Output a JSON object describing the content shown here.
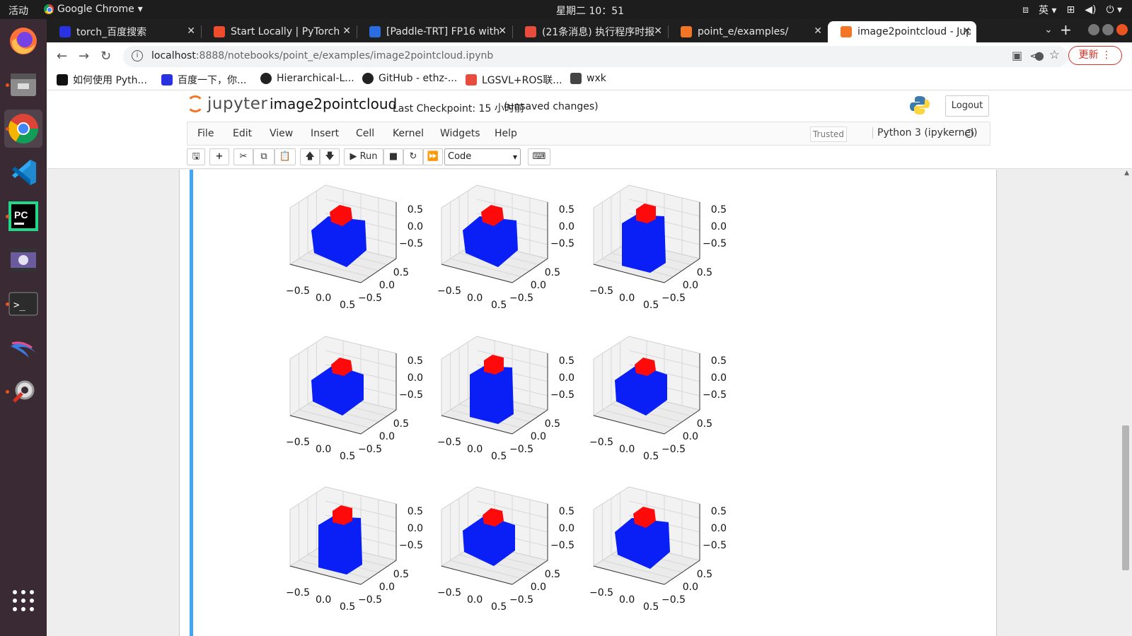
{
  "os": {
    "activities": "活动",
    "app_menu": "Google Chrome",
    "clock": "星期二 10：51",
    "input_method": "英"
  },
  "tabs": [
    {
      "title": "torch_百度搜索",
      "active": false,
      "color": "#2932e1"
    },
    {
      "title": "Start Locally | PyTorch",
      "active": false,
      "color": "#ee4c2c"
    },
    {
      "title": "[Paddle-TRT] FP16 with",
      "active": false,
      "color": "#2b6de0"
    },
    {
      "title": "(21条消息) 执行程序时报",
      "active": false,
      "color": "#e74c3c"
    },
    {
      "title": "point_e/examples/",
      "active": false,
      "color": "#f37626"
    },
    {
      "title": "image2pointcloud - Jup",
      "active": true,
      "color": "#f37626"
    }
  ],
  "address": {
    "host": "localhost",
    "path": ":8888/notebooks/point_e/examples/image2pointcloud.ipynb"
  },
  "update_label": "更新",
  "bookmarks": [
    {
      "label": "如何使用 Pyth...",
      "color": "#111"
    },
    {
      "label": "百度一下，你...",
      "color": "#2932e1"
    },
    {
      "label": "Hierarchical-L...",
      "color": "#222"
    },
    {
      "label": "GitHub - ethz-...",
      "color": "#222"
    },
    {
      "label": "LGSVL+ROS联...",
      "color": "#e74c3c"
    },
    {
      "label": "wxk",
      "color": "#444"
    }
  ],
  "jupyter": {
    "logo_text": "jupyter",
    "notebook_name": "image2pointcloud",
    "checkpoint": "Last Checkpoint: 15 小时前",
    "unsaved": "(unsaved changes)",
    "logout": "Logout",
    "menu": [
      "File",
      "Edit",
      "View",
      "Insert",
      "Cell",
      "Kernel",
      "Widgets",
      "Help"
    ],
    "trusted": "Trusted",
    "kernel": "Python 3 (ipykernel)",
    "run_label": "Run",
    "cell_type": "Code"
  },
  "plot_grid": {
    "rows": 3,
    "cols": 3,
    "z_ticks": [
      "0.5",
      "0.0",
      "−0.5"
    ],
    "y_ticks": [
      "0.5",
      "0.0",
      "−0.5"
    ],
    "x_ticks": [
      "−0.5",
      "0.0",
      "0.5"
    ],
    "colors": {
      "body": "#0a1ff5",
      "top": "#ff0a0a"
    },
    "subplots": [
      {
        "shape": "cube_tilted"
      },
      {
        "shape": "cube_tilted"
      },
      {
        "shape": "cube_front"
      },
      {
        "shape": "cube_diamond"
      },
      {
        "shape": "cube_front"
      },
      {
        "shape": "cube_diamond"
      },
      {
        "shape": "cube_front"
      },
      {
        "shape": "cube_diamond"
      },
      {
        "shape": "cube_tilted"
      }
    ]
  }
}
